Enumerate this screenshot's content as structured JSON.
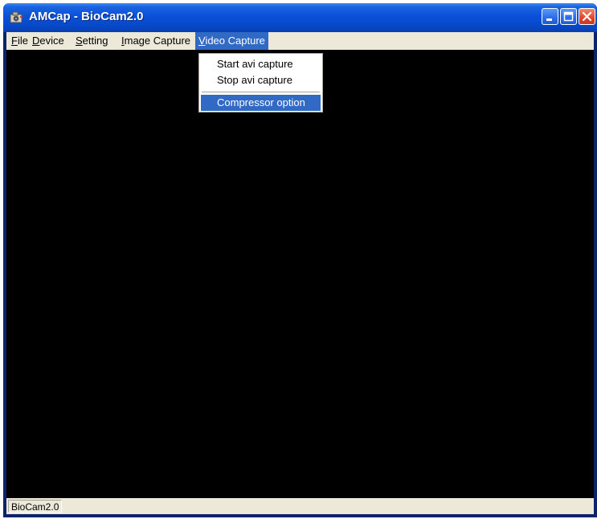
{
  "window": {
    "title": "AMCap - BioCam2.0",
    "icon": "camera-app-icon"
  },
  "titlebar_buttons": [
    {
      "name": "minimize",
      "icon": "minimize-icon"
    },
    {
      "name": "maximize",
      "icon": "maximize-icon"
    },
    {
      "name": "close",
      "icon": "close-icon"
    }
  ],
  "menubar": {
    "items": [
      {
        "label_mn": "F",
        "label_rest": "ile"
      },
      {
        "label_mn": "D",
        "label_rest": "evice"
      },
      {
        "label_mn": "S",
        "label_rest": "etting"
      },
      {
        "label_mn": "I",
        "label_rest": "mage Capture"
      },
      {
        "label_mn": "V",
        "label_rest": "ideo Capture"
      }
    ],
    "active_index": 4
  },
  "dropdown": {
    "items": [
      {
        "label": "Start avi capture"
      },
      {
        "label": "Stop avi capture"
      },
      {
        "label": "Compressor option"
      }
    ],
    "highlighted_index": 2
  },
  "statusbar": {
    "text": "BioCam2.0"
  },
  "colors": {
    "titlebar": "#0a50d8",
    "menu_highlight": "#316ac5",
    "client_background": "#000000",
    "chrome": "#ece9d8"
  }
}
